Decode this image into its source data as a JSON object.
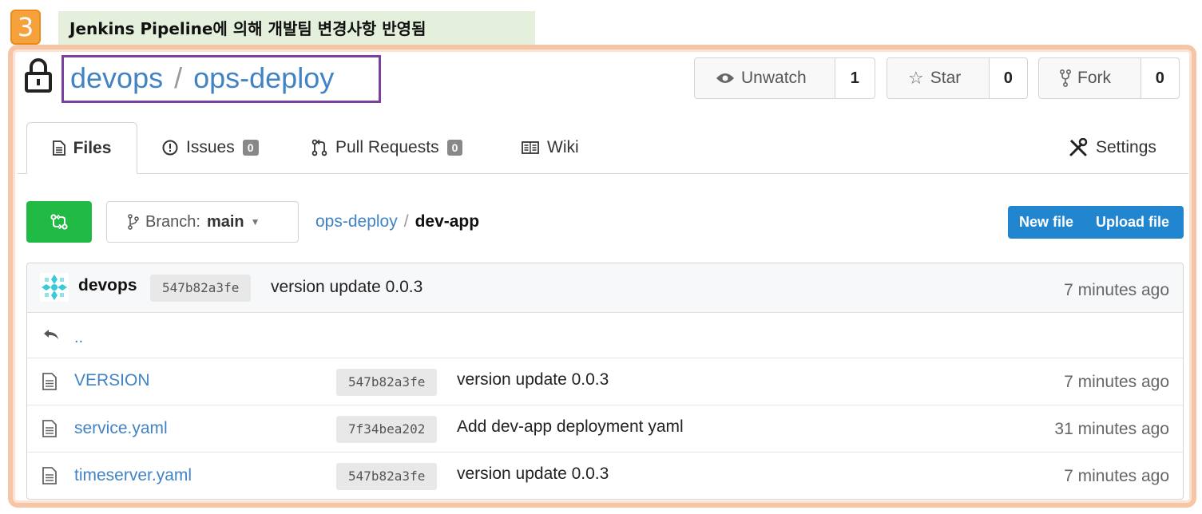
{
  "annotation": {
    "step": "3",
    "caption": "Jenkins Pipeline에 의해 개발팀 변경사항 반영됨"
  },
  "repo": {
    "owner": "devops",
    "separator": "/",
    "name": "ops-deploy"
  },
  "header_buttons": {
    "watch": {
      "label": "Unwatch",
      "count": "1"
    },
    "star": {
      "label": "Star",
      "count": "0"
    },
    "fork": {
      "label": "Fork",
      "count": "0"
    }
  },
  "tabs": {
    "files": "Files",
    "issues": {
      "label": "Issues",
      "count": "0"
    },
    "pulls": {
      "label": "Pull Requests",
      "count": "0"
    },
    "wiki": "Wiki",
    "settings": "Settings"
  },
  "toolbar": {
    "branch_prefix": "Branch:",
    "branch": "main",
    "breadcrumb": {
      "root": "ops-deploy",
      "separator": "/",
      "current": "dev-app"
    },
    "new_file": "New file",
    "upload_file": "Upload file"
  },
  "latest_commit": {
    "author": "devops",
    "sha": "547b82a3fe",
    "message": "version update 0.0.3",
    "age": "7 minutes ago"
  },
  "parent_link": "..",
  "files": [
    {
      "name": "VERSION",
      "sha": "547b82a3fe",
      "message": "version update 0.0.3",
      "age": "7 minutes ago"
    },
    {
      "name": "service.yaml",
      "sha": "7f34bea202",
      "message": "Add dev-app deployment yaml",
      "age": "31 minutes ago"
    },
    {
      "name": "timeserver.yaml",
      "sha": "547b82a3fe",
      "message": "version update 0.0.3",
      "age": "7 minutes ago"
    }
  ],
  "colors": {
    "link": "#4183c4",
    "green": "#21ba45",
    "blue": "#2185d0",
    "highlight_box": "#7a3fa0",
    "frame": "#f5c5a5",
    "badge": "#f6a23c"
  }
}
